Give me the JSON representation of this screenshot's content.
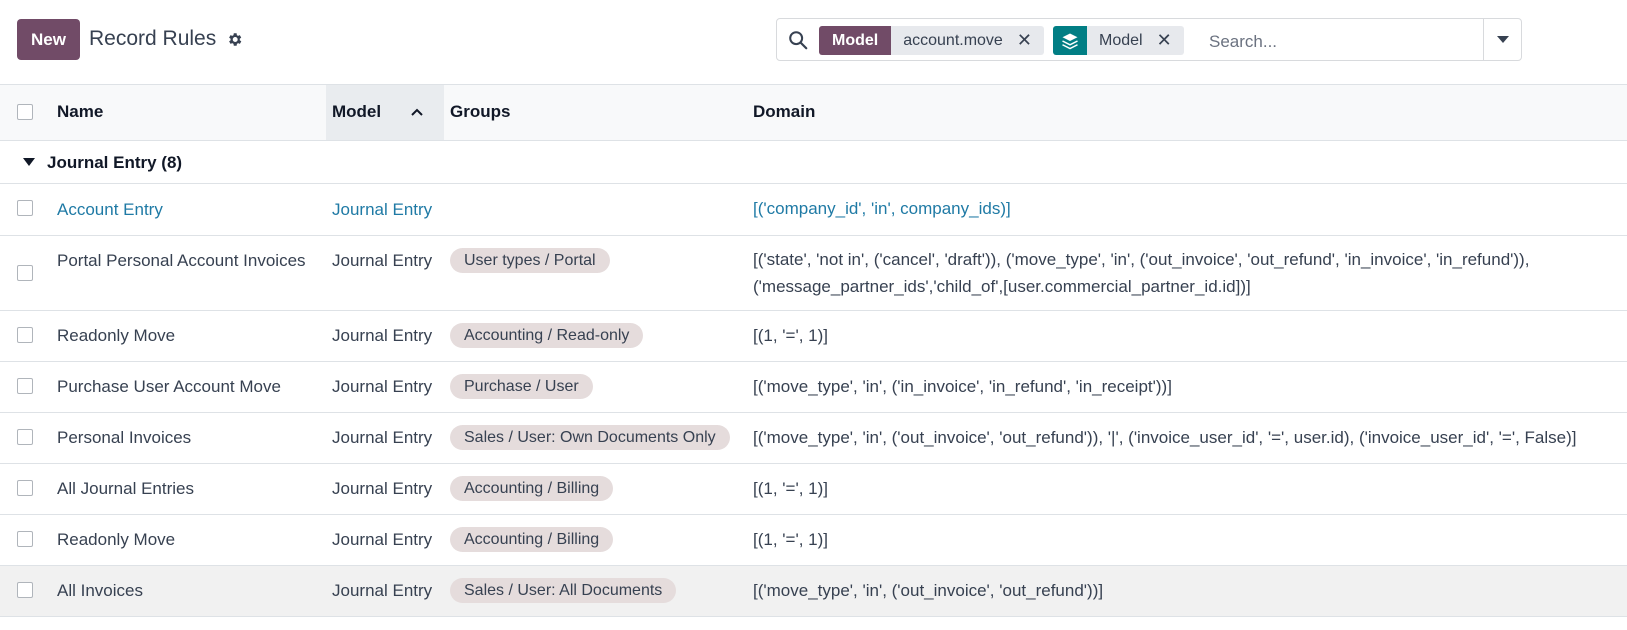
{
  "header": {
    "new_label": "New",
    "title": "Record Rules",
    "settings_icon": "gear-icon"
  },
  "search": {
    "icon": "search-icon",
    "facets": [
      {
        "type_label": "Model",
        "value": "account.move"
      },
      {
        "type_icon": "layers-icon",
        "value": "Model"
      }
    ],
    "remove_glyph": "✕",
    "placeholder": "Search..."
  },
  "table": {
    "columns": [
      "Name",
      "Model",
      "Groups",
      "Domain"
    ],
    "sorted_column": "Model",
    "group": {
      "label": "Journal Entry (8)"
    },
    "rows": [
      {
        "name": "Account Entry",
        "model": "Journal Entry",
        "groups": "",
        "domain": [
          "[('company_id', 'in', company_ids)]"
        ]
      },
      {
        "name": "Portal Personal Account Invoices",
        "model": "Journal Entry",
        "groups": "User types / Portal",
        "domain": [
          "[('state', 'not in', ('cancel', 'draft')), ('move_type', 'in', ('out_invoice', 'out_refund', 'in_invoice', 'in_refund')),",
          "('message_partner_ids','child_of',[user.commercial_partner_id.id])]"
        ]
      },
      {
        "name": "Readonly Move",
        "model": "Journal Entry",
        "groups": "Accounting / Read-only",
        "domain": [
          "[(1, '=', 1)]"
        ]
      },
      {
        "name": "Purchase User Account Move",
        "model": "Journal Entry",
        "groups": "Purchase / User",
        "domain": [
          "[('move_type', 'in', ('in_invoice', 'in_refund', 'in_receipt'))]"
        ]
      },
      {
        "name": "Personal Invoices",
        "model": "Journal Entry",
        "groups": "Sales / User: Own Documents Only",
        "domain": [
          "[('move_type', 'in', ('out_invoice', 'out_refund')), '|', ('invoice_user_id', '=', user.id), ('invoice_user_id', '=', False)]"
        ]
      },
      {
        "name": "All Journal Entries",
        "model": "Journal Entry",
        "groups": "Accounting / Billing",
        "domain": [
          "[(1, '=', 1)]"
        ]
      },
      {
        "name": "Readonly Move",
        "model": "Journal Entry",
        "groups": "Accounting / Billing",
        "domain": [
          "[(1, '=', 1)]"
        ]
      },
      {
        "name": "All Invoices",
        "model": "Journal Entry",
        "groups": "Sales / User: All Documents",
        "domain": [
          "[('move_type', 'in', ('out_invoice', 'out_refund'))]"
        ]
      }
    ]
  }
}
